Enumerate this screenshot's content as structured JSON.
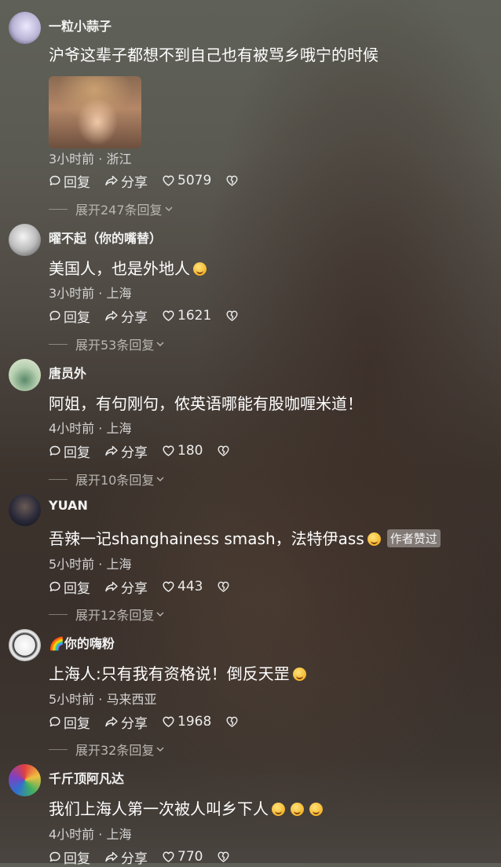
{
  "comments": [
    {
      "username": "一粒小蒜子",
      "text": "沪爷这辈子都想不到自己也有被骂乡哦宁的时候",
      "meta": "3小时前 · 浙江",
      "reply_label": "回复",
      "share_label": "分享",
      "likes": "5079",
      "expand": "展开247条回复",
      "has_image": true
    },
    {
      "username": "曜不起（你的嘴替）",
      "text": "美国人，也是外地人",
      "meta": "3小时前 · 上海",
      "reply_label": "回复",
      "share_label": "分享",
      "likes": "1621",
      "expand": "展开53条回复"
    },
    {
      "username": "唐员外",
      "text": "阿姐，有句刚句，侬英语哪能有股咖喱米道！",
      "meta": "4小时前 · 上海",
      "reply_label": "回复",
      "share_label": "分享",
      "likes": "180",
      "expand": "展开10条回复"
    },
    {
      "username": "YUAN",
      "text": "吾辣一记shanghainess smash，法特伊ass",
      "badge": "作者赞过",
      "meta": "5小时前 · 上海",
      "reply_label": "回复",
      "share_label": "分享",
      "likes": "443",
      "expand": "展开12条回复"
    },
    {
      "username": "🌈你的嗨粉",
      "text": "上海人:只有我有资格说！倒反天罡",
      "meta": "5小时前 · 马来西亚",
      "reply_label": "回复",
      "share_label": "分享",
      "likes": "1968",
      "expand": "展开32条回复"
    },
    {
      "username": "千斤顶阿凡达",
      "text": "我们上海人第一次被人叫乡下人",
      "meta": "4小时前 · 上海",
      "reply_label": "回复",
      "share_label": "分享",
      "likes": "770"
    }
  ]
}
